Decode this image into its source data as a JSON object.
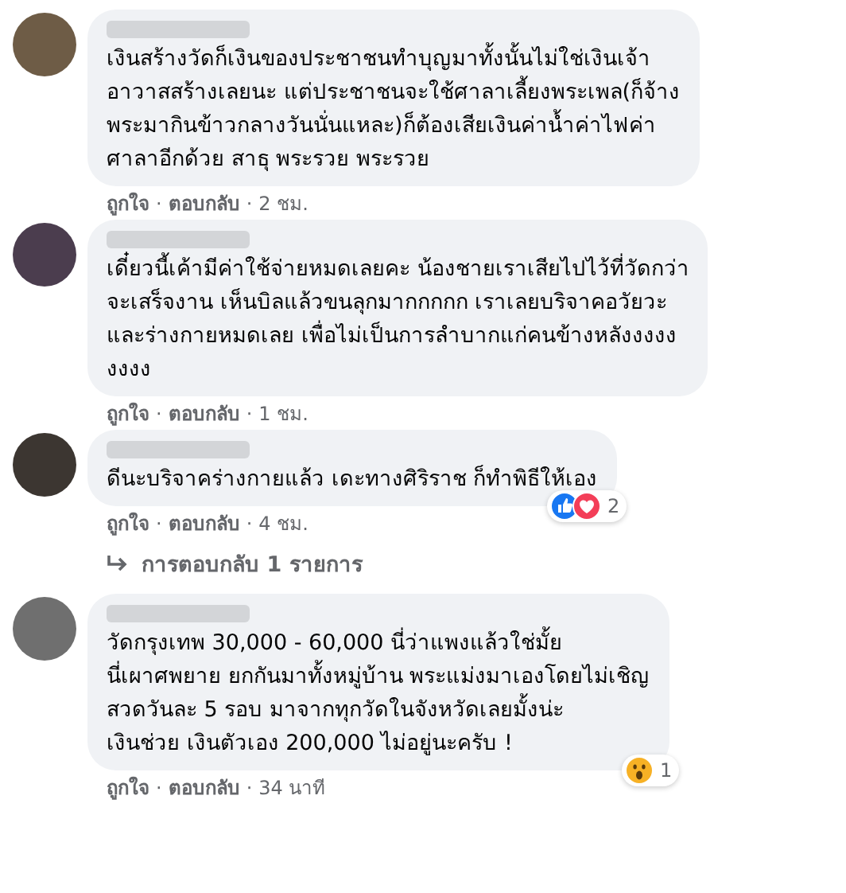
{
  "comments": [
    {
      "color": "#6e5c46",
      "lines": [
        "เงินสร้างวัดก็เงินของประชาชนทำบุญมาทั้งนั้นไม่ใช่เงินเจ้า",
        "อาวาสสร้างเลยนะ แต่ประชาชนจะใช้ศาลาเลี้ยงพระเพล(ก็จ้าง",
        "พระมากินข้าวกลางวันนั่นแหละ)ก็ต้องเสียเงินค่าน้ำค่าไฟค่า",
        "ศาลาอีกด้วย สาธุ พระรวย พระรวย"
      ],
      "like": "ถูกใจ",
      "reply": "ตอบกลับ",
      "time": "2 ชม.",
      "separators": [
        "·",
        "·"
      ]
    },
    {
      "color": "#4b3d4e",
      "lines": [
        "เดี๋ยวนี้เค้ามีค่าใช้จ่ายหมดเลยคะ น้องชายเราเสียไปไว้ที่วัดกว่า",
        "จะเสร็จงาน เห็นบิลแล้วขนลุกมากกกกก เราเลยบริจาคอวัยวะ",
        "และร่างกายหมดเลย เพื่อไม่เป็นการลำบากแก่คนข้างหลังงงงง",
        "งงงง"
      ],
      "like": "ถูกใจ",
      "reply": "ตอบกลับ",
      "time": "1 ชม.",
      "separators": [
        "·",
        "·"
      ]
    },
    {
      "color": "#3c3631",
      "lines": [
        "ดีนะบริจาคร่างกายแล้ว เดะทางศิริราช ก็ทำพิธีให้เอง"
      ],
      "like": "ถูกใจ",
      "reply": "ตอบกลับ",
      "time": "4 ชม.",
      "separators": [
        "·",
        "·"
      ],
      "reactions": {
        "icons": [
          {
            "kind": "like"
          },
          {
            "kind": "love"
          }
        ],
        "count": "2"
      },
      "replies_link": "การตอบกลับ 1 รายการ"
    },
    {
      "color": "#6f6f6f",
      "lines": [
        "วัดกรุงเทพ 30,000 - 60,000 นี่ว่าแพงแล้วใช่มั้ย",
        "นี่เผาศพยาย ยกกันมาทั้งหมู่บ้าน พระแม่งมาเองโดยไม่เชิญ",
        "สวดวันละ 5 รอบ มาจากทุกวัดในจังหวัดเลยมั้งน่ะ",
        "เงินช่วย เงินตัวเอง 200,000 ไม่อยู่นะครับ !"
      ],
      "like": "ถูกใจ",
      "reply": "ตอบกลับ",
      "time": "34 นาที",
      "separators": [
        "·",
        "·"
      ],
      "reactions": {
        "icons": [
          {
            "kind": "wow"
          }
        ],
        "count": "1"
      }
    }
  ]
}
